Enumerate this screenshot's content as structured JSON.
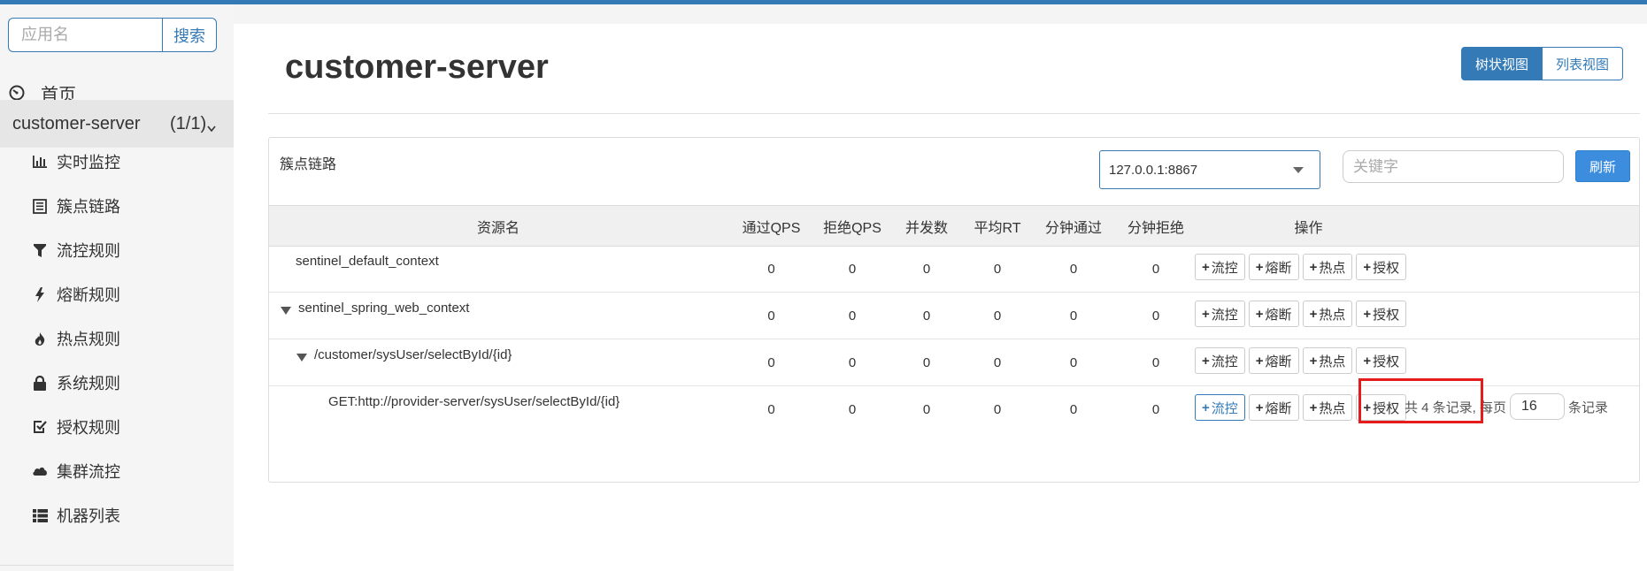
{
  "sidebar": {
    "search": {
      "placeholder": "应用名",
      "button": "搜索"
    },
    "home": {
      "label": "首页",
      "icon": "dashboard-icon"
    },
    "app": {
      "name": "customer-server",
      "count": "(1/1)",
      "icon": "chevron-down-icon"
    },
    "items": [
      {
        "label": "实时监控",
        "icon": "bar-chart-icon"
      },
      {
        "label": "簇点链路",
        "icon": "list-alt-icon"
      },
      {
        "label": "流控规则",
        "icon": "filter-icon"
      },
      {
        "label": "熔断规则",
        "icon": "flash-icon"
      },
      {
        "label": "热点规则",
        "icon": "fire-icon"
      },
      {
        "label": "系统规则",
        "icon": "lock-icon"
      },
      {
        "label": "授权规则",
        "icon": "check-icon"
      },
      {
        "label": "集群流控",
        "icon": "cloud-icon"
      },
      {
        "label": "机器列表",
        "icon": "th-list-icon"
      }
    ]
  },
  "main": {
    "title": "customer-server",
    "view_toggle": {
      "tree": "树状视图",
      "list": "列表视图",
      "active": "tree"
    },
    "panel": {
      "label": "簇点链路",
      "machine": "127.0.0.1:8867",
      "keyword_placeholder": "关键字",
      "refresh": "刷新"
    },
    "table": {
      "columns": [
        "资源名",
        "通过QPS",
        "拒绝QPS",
        "并发数",
        "平均RT",
        "分钟通过",
        "分钟拒绝",
        "操作"
      ],
      "rows": [
        {
          "name": "sentinel_default_context",
          "level": 0,
          "expanded": false,
          "values": [
            "0",
            "0",
            "0",
            "0",
            "0",
            "0"
          ]
        },
        {
          "name": "sentinel_spring_web_context",
          "level": 0,
          "expanded": true,
          "values": [
            "0",
            "0",
            "0",
            "0",
            "0",
            "0"
          ]
        },
        {
          "name": "/customer/sysUser/selectById/{id}",
          "level": 1,
          "expanded": true,
          "values": [
            "0",
            "0",
            "0",
            "0",
            "0",
            "0"
          ]
        },
        {
          "name": "GET:http://provider-server/sysUser/selectById/{id}",
          "level": 2,
          "expanded": false,
          "values": [
            "0",
            "0",
            "0",
            "0",
            "0",
            "0"
          ]
        }
      ],
      "actions": [
        "流控",
        "熔断",
        "热点",
        "授权"
      ]
    },
    "pager": {
      "prefix": "共 4 条记录, 每页",
      "page_size": "16",
      "suffix": "条记录"
    }
  },
  "colors": {
    "primary": "#337ab7",
    "highlight": "#e51c1c"
  }
}
